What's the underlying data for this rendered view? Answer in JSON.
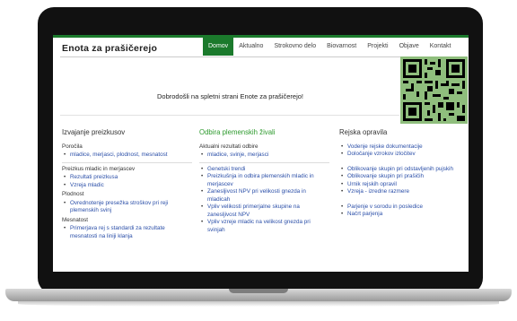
{
  "site": {
    "title": "Enota za prašičerejo",
    "nav": [
      "Domov",
      "Aktualno",
      "Strokovno delo",
      "Biovarnost",
      "Projekti",
      "Objave",
      "Kontakt"
    ],
    "active_nav": "Domov",
    "welcome": "Dobrodošli na spletni strani Enote za prašičerejo!"
  },
  "col1": {
    "title": "Izvajanje preizkusov",
    "sub1": "Poročila",
    "sub1_items": [
      "mladice, merjasci, plodnost, mesnatost"
    ],
    "sub2": "Preizkus mladic in merjascev",
    "sub2_items": [
      "Rezultati preizkusa",
      "Vzreja mladic"
    ],
    "sub3": "Plodnost",
    "sub3_items": [
      "Ovrednotenje presežka stroškov pri reji plemenskih svinj"
    ],
    "sub4": "Mesnatost",
    "sub4_items": [
      "Primerjava rej s standardi za rezultate mesnatosti na liniji klanja"
    ]
  },
  "col2": {
    "title": "Odbira plemenskih živali",
    "sub1": "Aktualni rezultati odbire",
    "sub1_items": [
      "mladice, svinje, merjasci"
    ],
    "items": [
      "Genetski trendi",
      "Preizkušnja in odbira plemenskih mladic in merjascev",
      "Zanesljivost NPV pri velikosti gnezda in mladicah",
      "Vpliv velikosti primerjalne skupine na zanesljivost NPV",
      "Vpliv vzreje mladic na velikost gnezda pri svinjah"
    ]
  },
  "col3": {
    "title": "Rejska opravila",
    "group1": [
      "Vodenje rejske dokumentacije",
      "Določanje vzrokov izločitev"
    ],
    "group2": [
      "Oblikovanje skupin pri odstavljenih pujskih",
      "Oblikovanje skupin pri prašičih",
      "Urnik rejskih opravil",
      "Vzreja - izredne razmere"
    ],
    "group3": [
      "Parjenje v sorodu in posledice",
      "Načrt parjenja"
    ]
  },
  "colors": {
    "accent": "#1b7a2c",
    "link": "#2b4fa8",
    "qr_bg": "#8fbe7d"
  }
}
